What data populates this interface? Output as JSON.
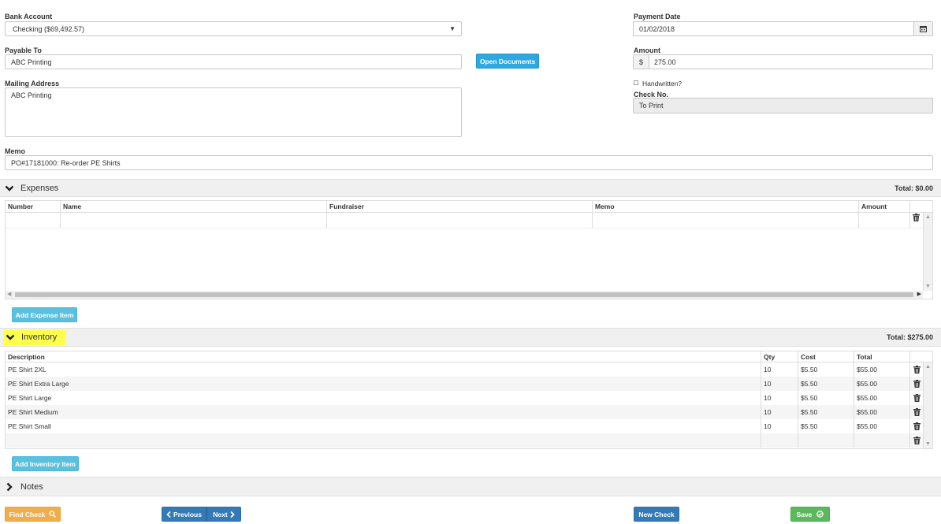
{
  "form": {
    "bank_account": {
      "label": "Bank Account",
      "value": "Checking ($69,492.57)"
    },
    "payment_date": {
      "label": "Payment Date",
      "value": "01/02/2018"
    },
    "payable_to": {
      "label": "Payable To",
      "value": "ABC Printing"
    },
    "open_documents_label": "Open Documents",
    "amount": {
      "label": "Amount",
      "currency": "$",
      "value": "275.00"
    },
    "mailing_address": {
      "label": "Mailing Address",
      "value": "ABC Printing"
    },
    "handwritten_label": "Handwritten?",
    "check_no": {
      "label": "Check No.",
      "value": "To Print"
    },
    "memo": {
      "label": "Memo",
      "value": "PO#17181000: Re-order PE Shirts"
    }
  },
  "expenses": {
    "title": "Expenses",
    "total": "Total: $0.00",
    "columns": [
      "Number",
      "Name",
      "Fundraiser",
      "Memo",
      "Amount"
    ],
    "add_label": "Add Expense Item"
  },
  "inventory": {
    "title": "Inventory",
    "total": "Total: $275.00",
    "columns": [
      "Description",
      "Qty",
      "Cost",
      "Total"
    ],
    "rows": [
      {
        "description": "PE Shirt 2XL",
        "qty": "10",
        "cost": "$5.50",
        "total": "$55.00"
      },
      {
        "description": "PE Shirt Extra Large",
        "qty": "10",
        "cost": "$5.50",
        "total": "$55.00"
      },
      {
        "description": "PE Shirt Large",
        "qty": "10",
        "cost": "$5.50",
        "total": "$55.00"
      },
      {
        "description": "PE Shirt Medium",
        "qty": "10",
        "cost": "$5.50",
        "total": "$55.00"
      },
      {
        "description": "PE Shirt Small",
        "qty": "10",
        "cost": "$5.50",
        "total": "$55.00"
      }
    ],
    "add_label": "Add Inventory Item",
    "highlight_color": "#ffff4d"
  },
  "notes": {
    "title": "Notes"
  },
  "footer": {
    "find_check_label": "Find Check",
    "previous_label": "Previous",
    "next_label": "Next",
    "new_check_label": "New Check",
    "save_label": "Save"
  }
}
